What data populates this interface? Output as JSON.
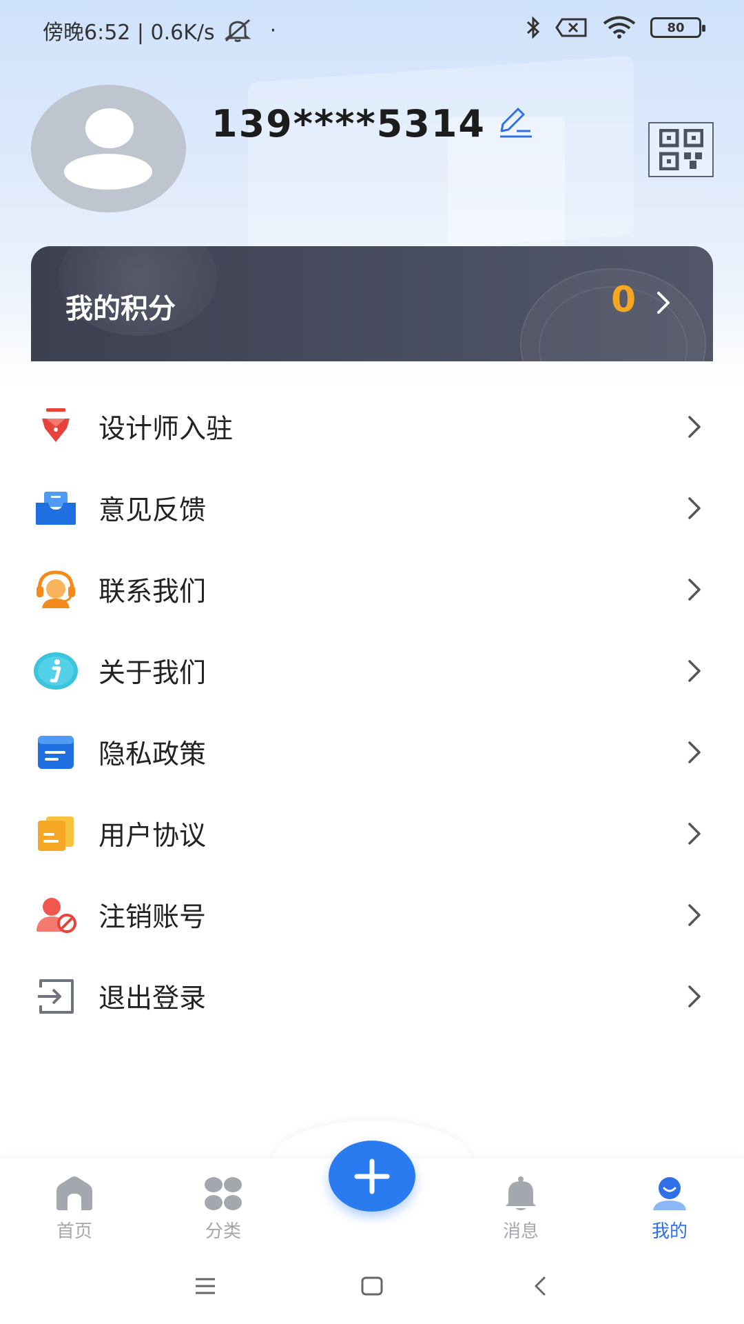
{
  "status_bar": {
    "time_text": "傍晚6:52 | 0.6K/s",
    "dot": "·",
    "battery": "80",
    "icons": [
      "mute-icon",
      "bluetooth-icon",
      "sim-x-icon",
      "wifi-icon",
      "battery-icon"
    ]
  },
  "profile": {
    "phone": "139****5314",
    "icons": [
      "avatar-placeholder-icon",
      "edit-icon",
      "qr-code-icon"
    ]
  },
  "points": {
    "title": "我的积分",
    "value": "0",
    "accent_color": "#f5a623"
  },
  "menu": {
    "items": [
      {
        "label": "设计师入驻",
        "icon": "pen-nib-icon"
      },
      {
        "label": "意见反馈",
        "icon": "inbox-icon"
      },
      {
        "label": "联系我们",
        "icon": "headset-icon"
      },
      {
        "label": "关于我们",
        "icon": "info-icon"
      },
      {
        "label": "隐私政策",
        "icon": "document-icon"
      },
      {
        "label": "用户协议",
        "icon": "agreement-icon"
      },
      {
        "label": "注销账号",
        "icon": "user-block-icon"
      },
      {
        "label": "退出登录",
        "icon": "logout-icon"
      }
    ]
  },
  "bottom_nav": {
    "items": [
      {
        "label": "首页",
        "icon": "home-icon",
        "active": false
      },
      {
        "label": "分类",
        "icon": "category-icon",
        "active": false
      },
      {
        "label": "消息",
        "icon": "bell-icon",
        "active": false
      },
      {
        "label": "我的",
        "icon": "profile-icon",
        "active": true
      }
    ],
    "center_button_icon": "plus-icon",
    "active_color": "#2f6fe8",
    "inactive_color": "#a3a7ae"
  },
  "system_nav": {
    "icons": [
      "menu-icon",
      "home-square-icon",
      "back-icon"
    ]
  }
}
